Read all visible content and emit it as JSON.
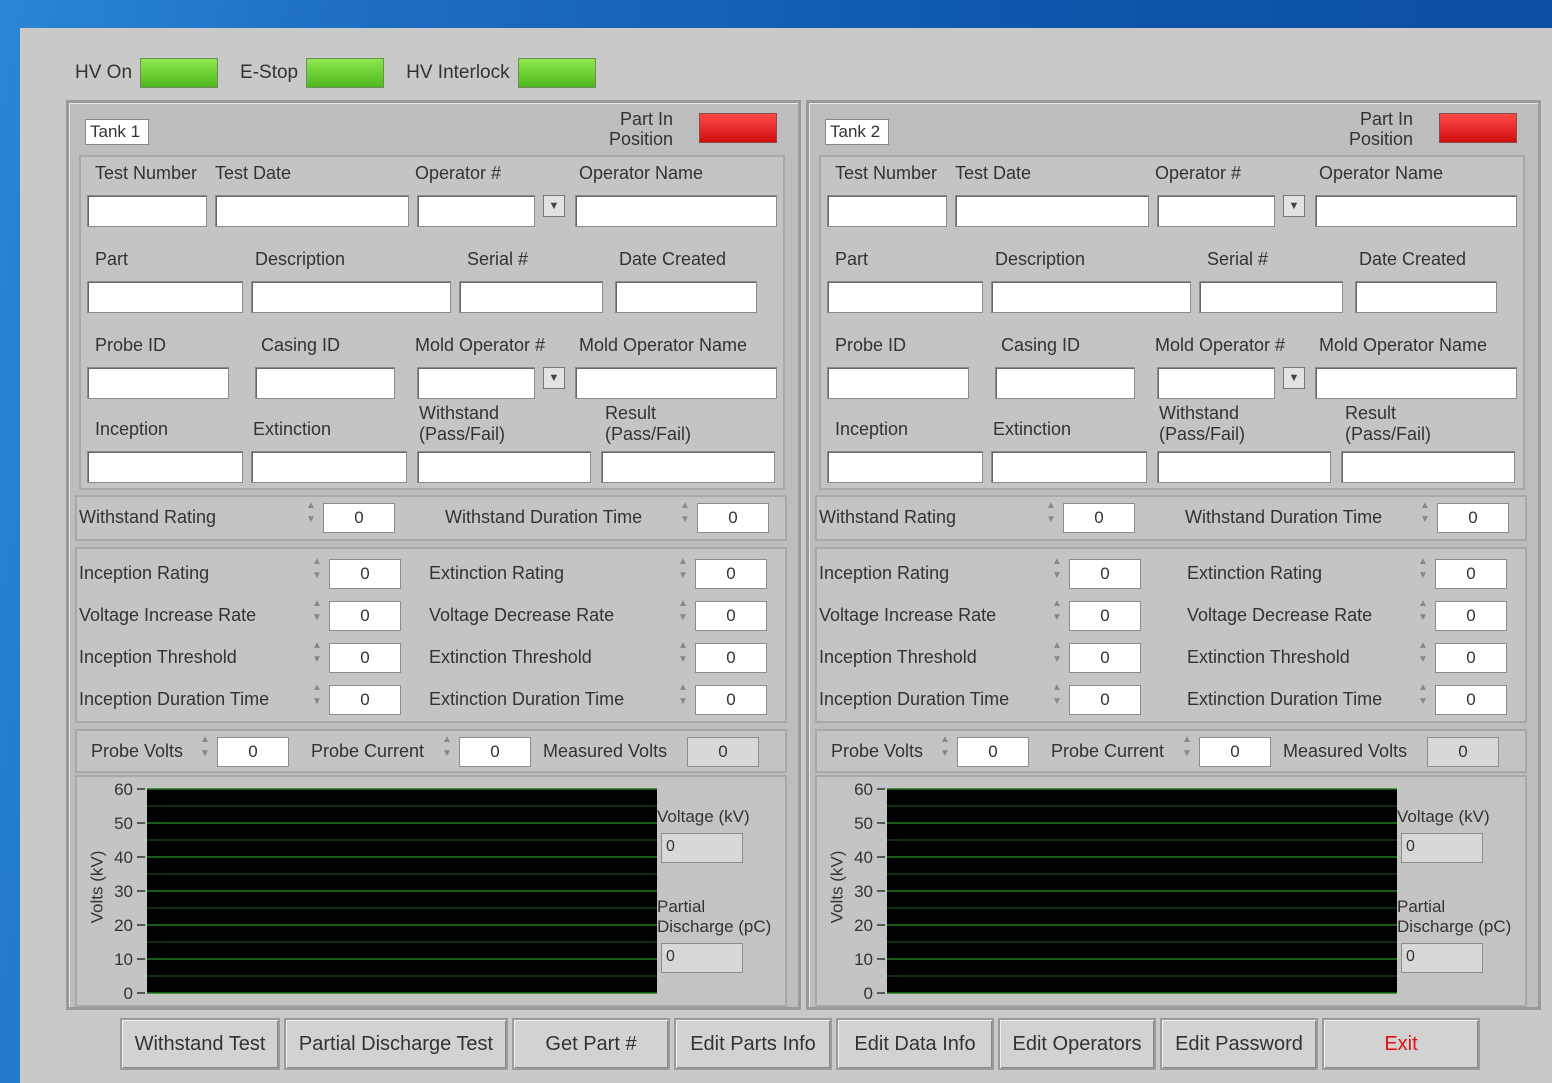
{
  "indicators": [
    {
      "label": "HV On",
      "state": "on"
    },
    {
      "label": "E-Stop",
      "state": "on"
    },
    {
      "label": "HV Interlock",
      "state": "on"
    }
  ],
  "tanks": [
    {
      "title": "Tank 1",
      "part_in_position": "Part In\nPosition",
      "fields": {
        "test_number": "Test Number",
        "test_date": "Test Date",
        "operator_num": "Operator #",
        "operator_name": "Operator Name",
        "part": "Part",
        "description": "Description",
        "serial": "Serial #",
        "date_created": "Date Created",
        "probe_id": "Probe ID",
        "casing_id": "Casing ID",
        "mold_operator_num": "Mold Operator #",
        "mold_operator_name": "Mold Operator Name",
        "inception": "Inception",
        "extinction": "Extinction",
        "withstand": "Withstand\n(Pass/Fail)",
        "result": "Result\n(Pass/Fail)"
      },
      "withstand_rating": {
        "label": "Withstand Rating",
        "value": "0"
      },
      "withstand_duration": {
        "label": "Withstand Duration Time",
        "value": "0"
      },
      "inception_rating": {
        "label": "Inception Rating",
        "value": "0"
      },
      "extinction_rating": {
        "label": "Extinction Rating",
        "value": "0"
      },
      "voltage_increase": {
        "label": "Voltage Increase Rate",
        "value": "0"
      },
      "voltage_decrease": {
        "label": "Voltage Decrease Rate",
        "value": "0"
      },
      "inception_threshold": {
        "label": "Inception Threshold",
        "value": "0"
      },
      "extinction_threshold": {
        "label": "Extinction Threshold",
        "value": "0"
      },
      "inception_duration": {
        "label": "Inception Duration Time",
        "value": "0"
      },
      "extinction_duration": {
        "label": "Extinction Duration Time",
        "value": "0"
      },
      "probe_volts": {
        "label": "Probe Volts",
        "value": "0"
      },
      "probe_current": {
        "label": "Probe Current",
        "value": "0"
      },
      "measured_volts": {
        "label": "Measured Volts",
        "value": "0"
      },
      "graph": {
        "y_title": "Volts (kV)",
        "ticks": [
          "60",
          "50",
          "40",
          "30",
          "20",
          "10",
          "0"
        ]
      },
      "voltage_kv": {
        "label": "Voltage (kV)",
        "value": "0"
      },
      "partial_discharge": {
        "label": "Partial\nDischarge (pC)",
        "value": "0"
      }
    },
    {
      "title": "Tank 2",
      "part_in_position": "Part In\nPosition",
      "fields": {
        "test_number": "Test Number",
        "test_date": "Test Date",
        "operator_num": "Operator #",
        "operator_name": "Operator Name",
        "part": "Part",
        "description": "Description",
        "serial": "Serial #",
        "date_created": "Date Created",
        "probe_id": "Probe ID",
        "casing_id": "Casing ID",
        "mold_operator_num": "Mold Operator #",
        "mold_operator_name": "Mold Operator Name",
        "inception": "Inception",
        "extinction": "Extinction",
        "withstand": "Withstand\n(Pass/Fail)",
        "result": "Result\n(Pass/Fail)"
      },
      "withstand_rating": {
        "label": "Withstand Rating",
        "value": "0"
      },
      "withstand_duration": {
        "label": "Withstand Duration Time",
        "value": "0"
      },
      "inception_rating": {
        "label": "Inception Rating",
        "value": "0"
      },
      "extinction_rating": {
        "label": "Extinction Rating",
        "value": "0"
      },
      "voltage_increase": {
        "label": "Voltage Increase Rate",
        "value": "0"
      },
      "voltage_decrease": {
        "label": "Voltage Decrease Rate",
        "value": "0"
      },
      "inception_threshold": {
        "label": "Inception Threshold",
        "value": "0"
      },
      "extinction_threshold": {
        "label": "Extinction Threshold",
        "value": "0"
      },
      "inception_duration": {
        "label": "Inception Duration Time",
        "value": "0"
      },
      "extinction_duration": {
        "label": "Extinction Duration Time",
        "value": "0"
      },
      "probe_volts": {
        "label": "Probe Volts",
        "value": "0"
      },
      "probe_current": {
        "label": "Probe Current",
        "value": "0"
      },
      "measured_volts": {
        "label": "Measured Volts",
        "value": "0"
      },
      "graph": {
        "y_title": "Volts (kV)",
        "ticks": [
          "60",
          "50",
          "40",
          "30",
          "20",
          "10",
          "0"
        ]
      },
      "voltage_kv": {
        "label": "Voltage (kV)",
        "value": "0"
      },
      "partial_discharge": {
        "label": "Partial\nDischarge (pC)",
        "value": "0"
      }
    }
  ],
  "buttons": [
    {
      "label": "Withstand Test"
    },
    {
      "label": "Partial Discharge Test"
    },
    {
      "label": "Get Part #"
    },
    {
      "label": "Edit Parts Info"
    },
    {
      "label": "Edit Data Info"
    },
    {
      "label": "Edit Operators"
    },
    {
      "label": "Edit Password"
    },
    {
      "label": "Exit"
    }
  ],
  "colors": {
    "led_on": "#5fcc2a",
    "led_alarm": "#e81a1a",
    "graph_bg": "#000000",
    "graph_grid": "#1f7a1f"
  }
}
